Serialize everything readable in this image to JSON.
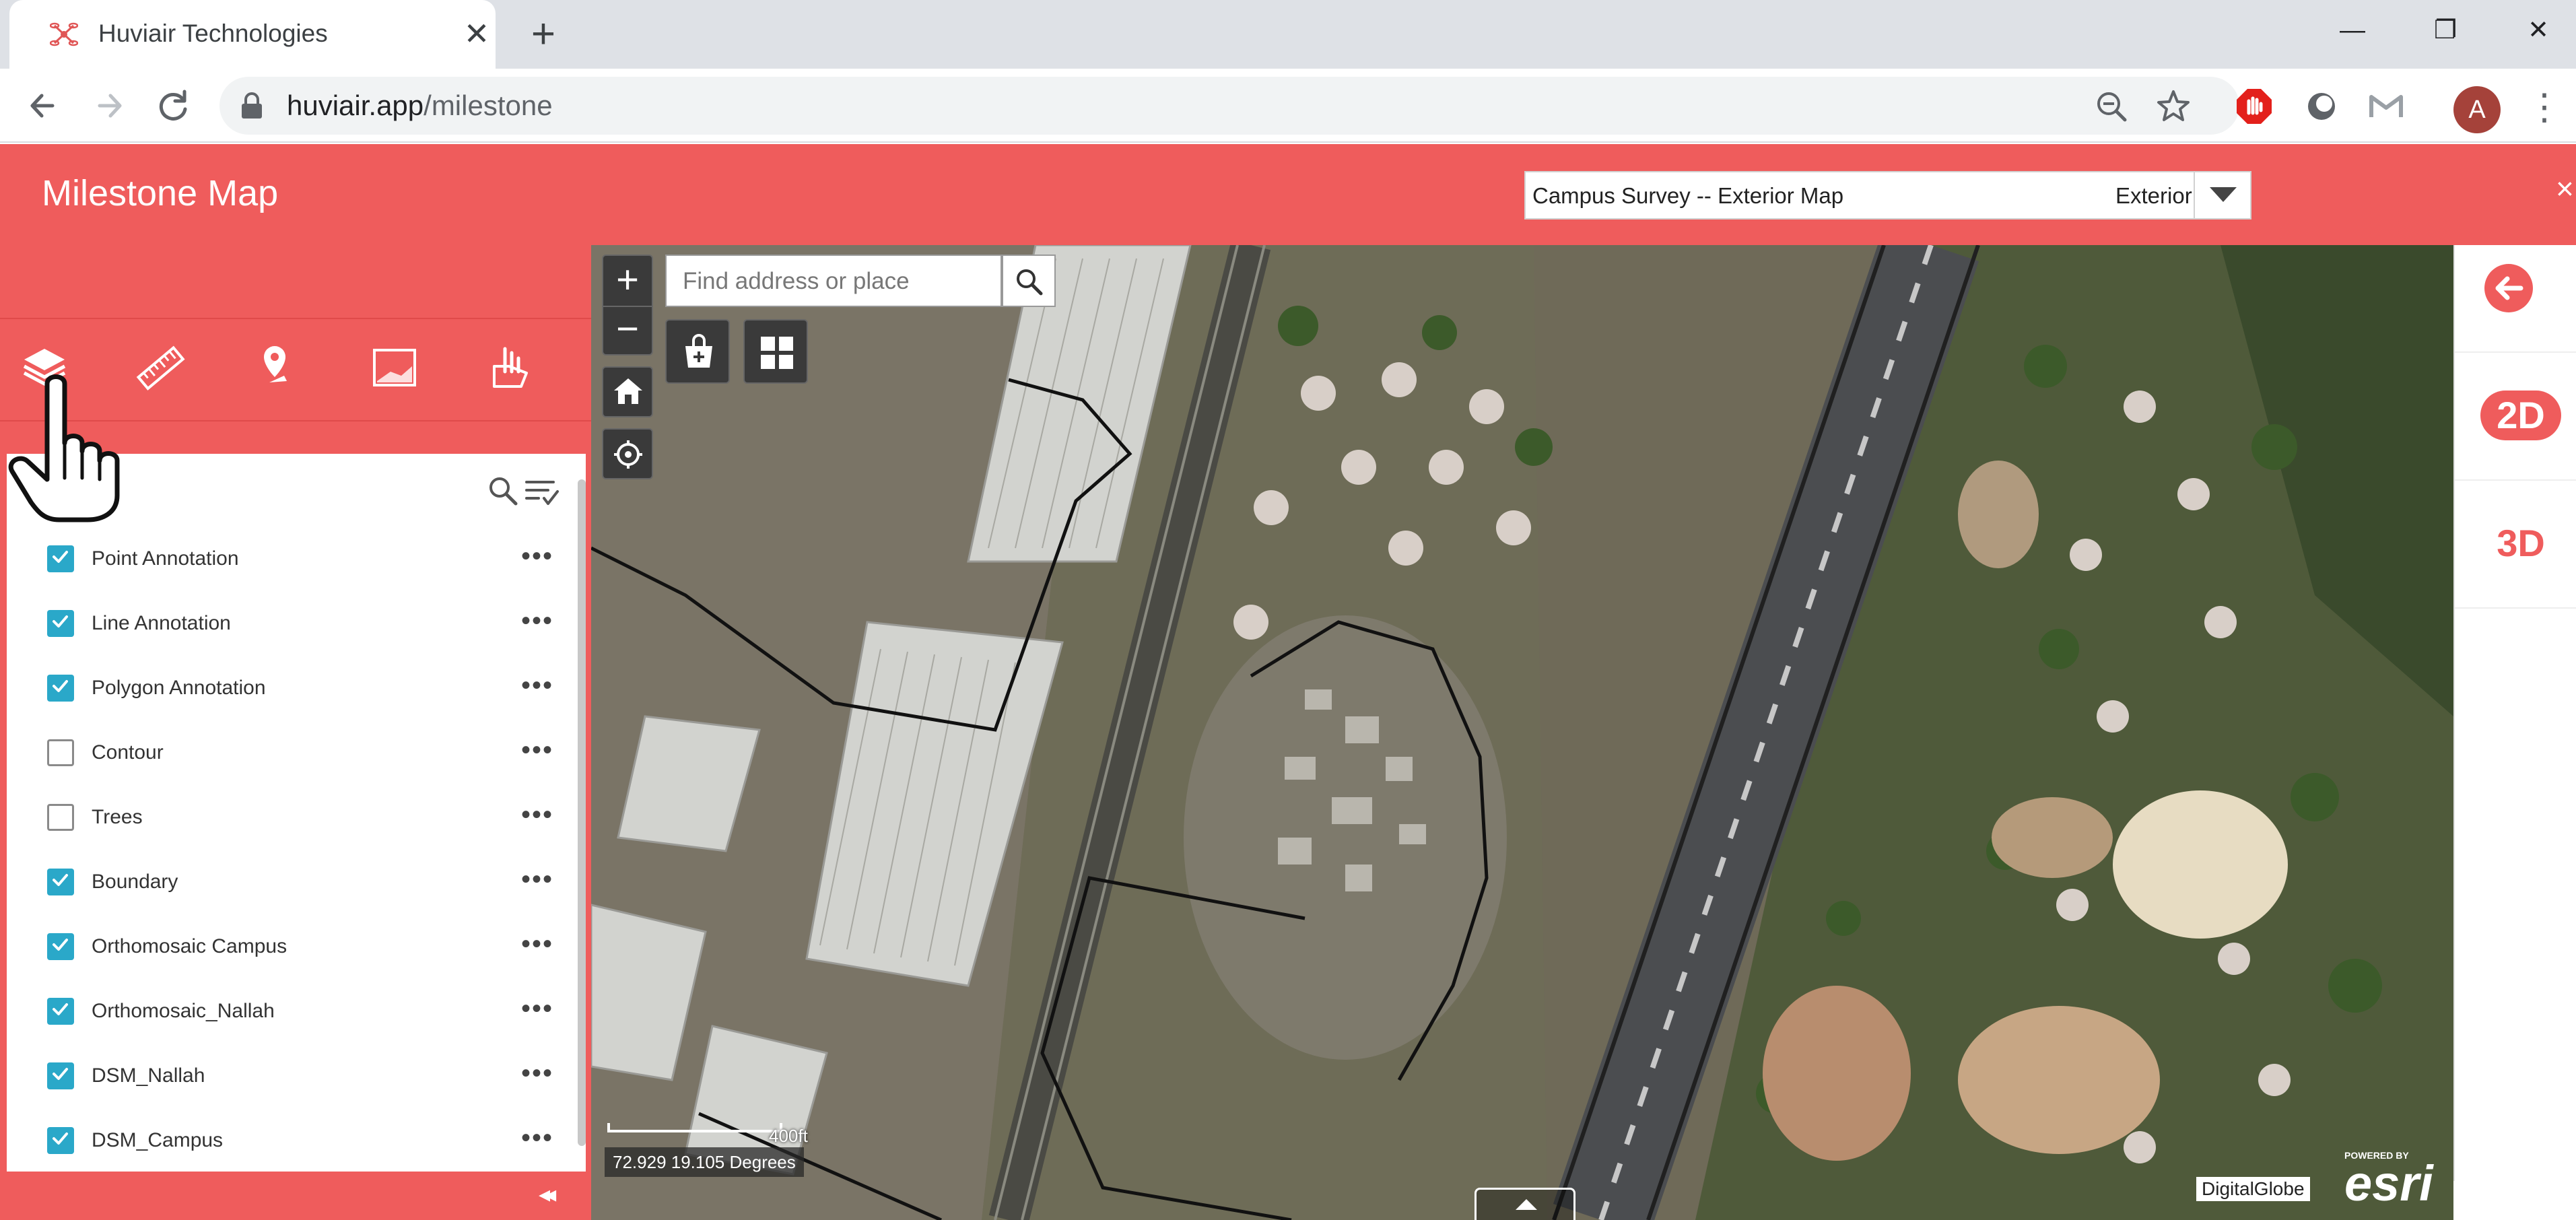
{
  "browser": {
    "tab_title": "Huviair Technologies",
    "tab_close": "✕",
    "new_tab": "+",
    "url_domain": "huviair.app",
    "url_path": "/milestone",
    "profile_initial": "A",
    "window_buttons": {
      "minimize": "—",
      "restore": "❐",
      "close": "✕"
    }
  },
  "app": {
    "title": "Milestone Map",
    "project_name": "Campus Survey -- Exterior Map",
    "project_mode": "Exterior",
    "close": "×",
    "accent_color": "#ef5c5c",
    "checkbox_color": "#2aa8c9"
  },
  "tools": [
    "layers-icon",
    "ruler-icon",
    "marker-pin-icon",
    "map-frame-icon",
    "swipe-tool-icon"
  ],
  "layers": [
    {
      "label": "Point Annotation",
      "checked": true
    },
    {
      "label": "Line Annotation",
      "checked": true
    },
    {
      "label": "Polygon Annotation",
      "checked": true
    },
    {
      "label": "Contour",
      "checked": false
    },
    {
      "label": "Trees",
      "checked": false
    },
    {
      "label": "Boundary",
      "checked": true
    },
    {
      "label": "Orthomosaic Campus",
      "checked": true
    },
    {
      "label": "Orthomosaic_Nallah",
      "checked": true
    },
    {
      "label": "DSM_Nallah",
      "checked": true
    },
    {
      "label": "DSM_Campus",
      "checked": true
    }
  ],
  "layer_more": "•••",
  "panel": {
    "collapse": "◂◂"
  },
  "map": {
    "search_placeholder": "Find address or place",
    "zoom_in": "+",
    "zoom_out": "−",
    "scale": "400ft",
    "coordinates": "72.929 19.105 Degrees",
    "attribution": "DigitalGlobe",
    "esri_powered": "POWERED BY",
    "esri_word": "esri"
  },
  "rail": {
    "mode_2d": "2D",
    "mode_3d": "3D"
  }
}
